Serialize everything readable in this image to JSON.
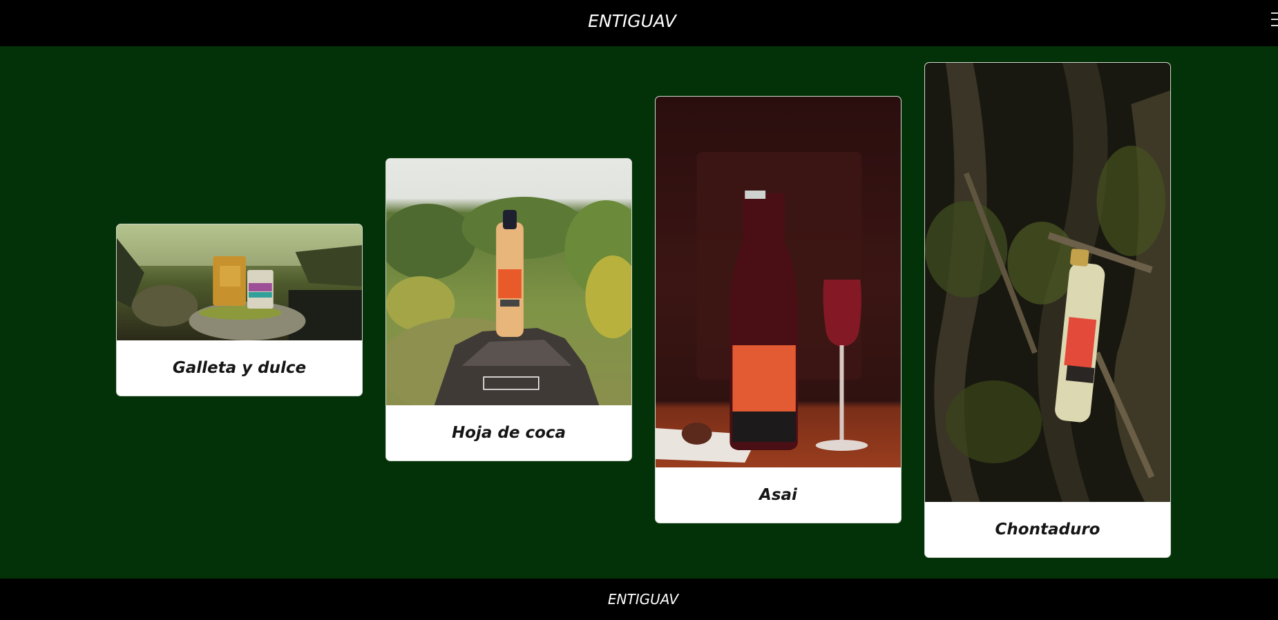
{
  "header": {
    "brand": "ENTIGUAV",
    "menu_icon": "hamburger-icon"
  },
  "products": [
    {
      "caption": "Galleta y dulce",
      "image_alt": "Galleta y dulce"
    },
    {
      "caption": "Hoja de coca",
      "image_alt": "Hoja de coca"
    },
    {
      "caption": "Asai",
      "image_alt": "Asai"
    },
    {
      "caption": "Chontaduro",
      "image_alt": "Chontaduro"
    }
  ],
  "footer": {
    "brand": "ENTIGUAV"
  },
  "colors": {
    "page_bg": "#043208",
    "bar_bg": "#000000",
    "card_bg": "#ffffff"
  }
}
